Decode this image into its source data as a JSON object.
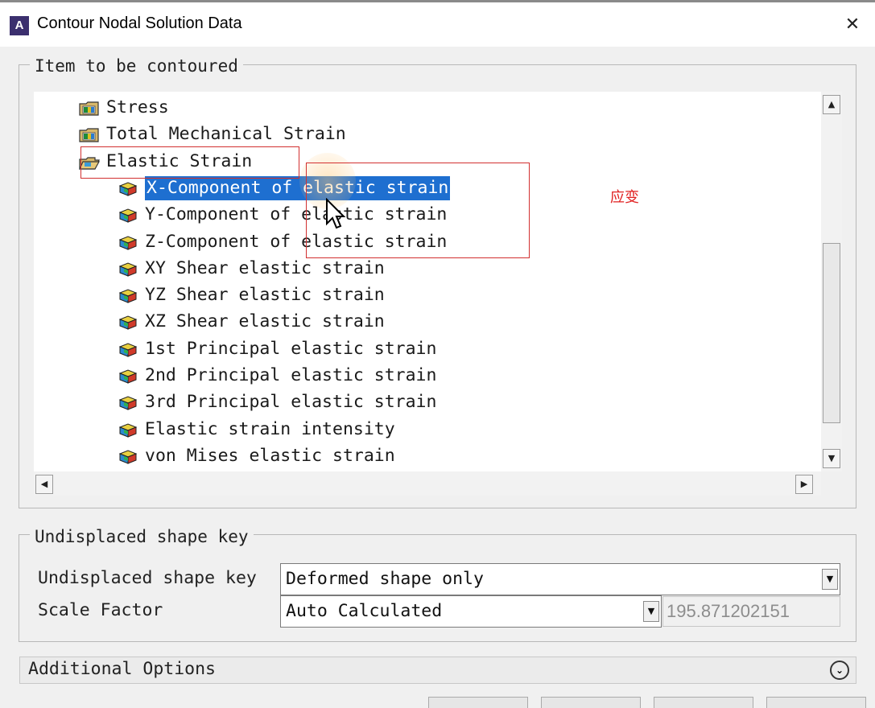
{
  "window": {
    "app_icon_letter": "A",
    "title": "Contour Nodal Solution Data",
    "close_glyph": "✕"
  },
  "item_group": {
    "legend": "Item to be contoured",
    "tree": {
      "categories": [
        {
          "label": "Stress",
          "icon": "folder-closed-icon"
        },
        {
          "label": "Total Mechanical Strain",
          "icon": "folder-closed-icon"
        },
        {
          "label": "Elastic Strain",
          "icon": "folder-open-icon"
        }
      ],
      "items": [
        {
          "label": "X-Component of elastic strain",
          "selected": true
        },
        {
          "label": "Y-Component of elastic strain"
        },
        {
          "label": "Z-Component of elastic strain"
        },
        {
          "label": "XY Shear elastic strain"
        },
        {
          "label": "YZ Shear elastic strain"
        },
        {
          "label": "XZ Shear elastic strain"
        },
        {
          "label": "1st Principal elastic strain"
        },
        {
          "label": "2nd Principal elastic strain"
        },
        {
          "label": "3rd Principal elastic strain"
        },
        {
          "label": "Elastic strain intensity"
        },
        {
          "label": "von Mises elastic strain"
        }
      ]
    }
  },
  "undisplaced_group": {
    "legend": "Undisplaced shape key",
    "shape_key_label": "Undisplaced shape key",
    "shape_key_value": "Deformed shape only",
    "scale_label": "Scale Factor",
    "scale_value": "Auto Calculated",
    "scale_number": "195.871202151"
  },
  "additional_options": {
    "label": "Additional Options"
  },
  "annotation": {
    "text": "应变",
    "color": "#e02020"
  },
  "colors": {
    "selection": "#1e6fd0",
    "annotation_border": "#d23030"
  }
}
